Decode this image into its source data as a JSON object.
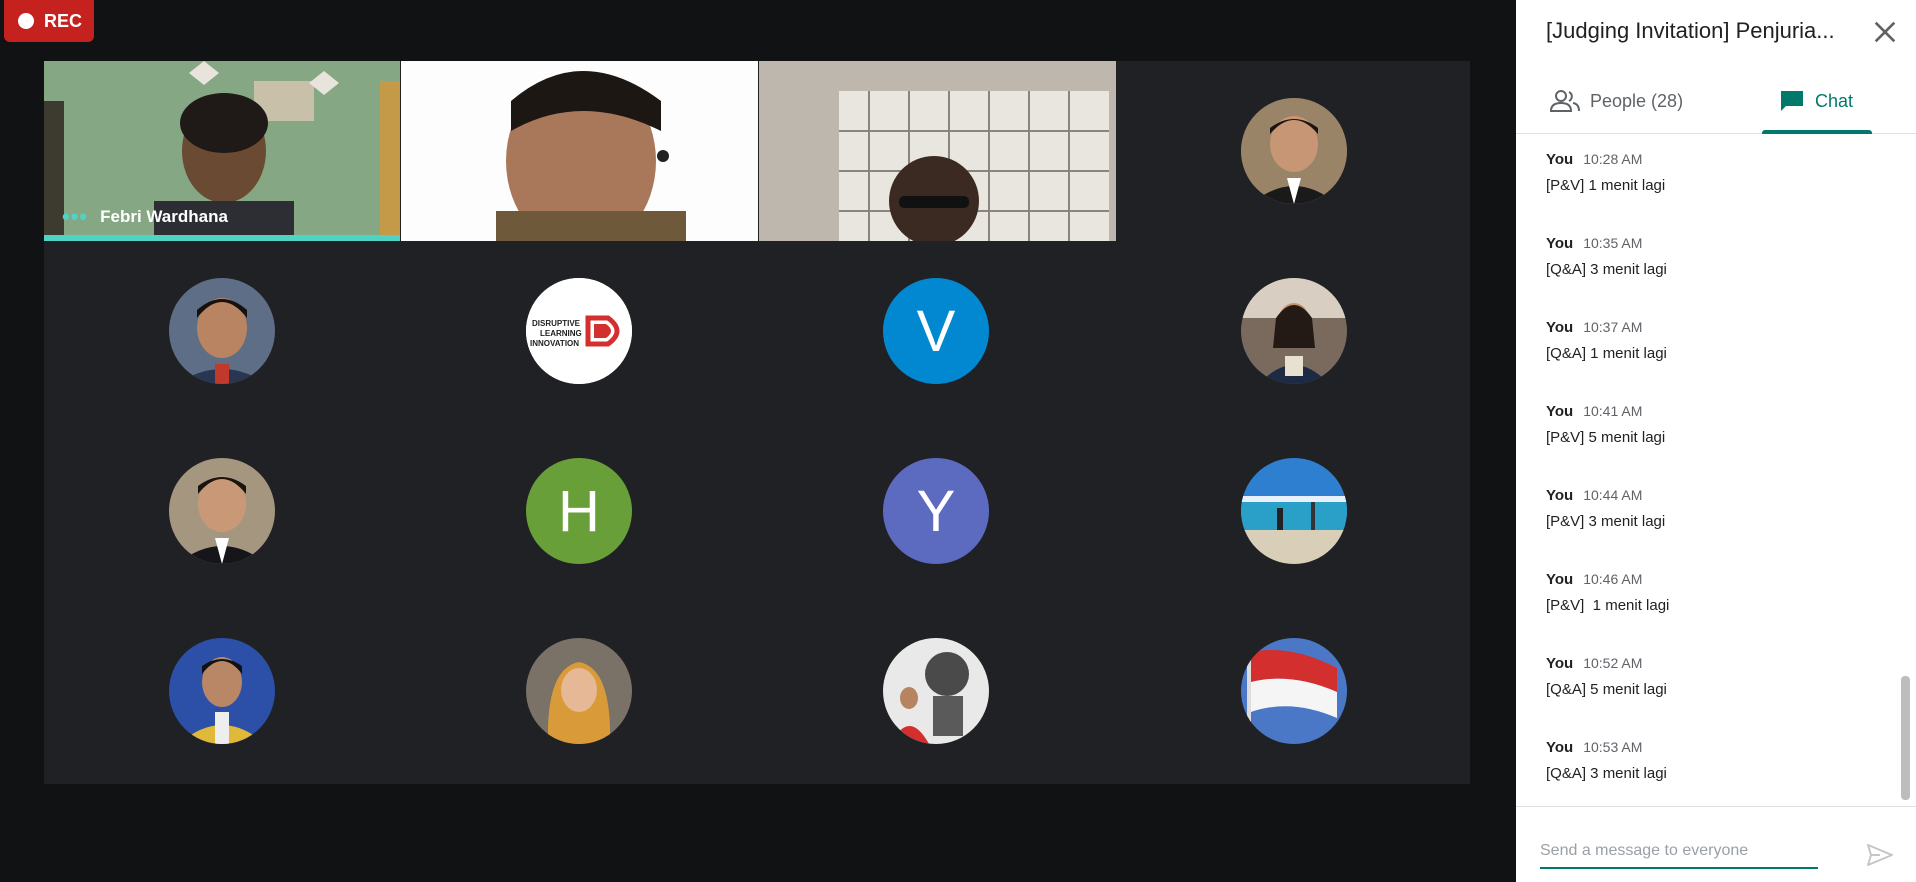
{
  "rec": {
    "label": "REC"
  },
  "videos": [
    {
      "name": "Febri Wardhana",
      "bg": "#7fa07e",
      "active": true
    },
    {
      "name": "",
      "bg": "#d9c9b6",
      "active": false
    },
    {
      "name": "",
      "bg": "#b4b0a8",
      "active": false
    }
  ],
  "participants": [
    {
      "type": "photo",
      "color": "#6b5a4a",
      "icon": "person-photo-icon"
    },
    {
      "type": "photo",
      "color": "#5d6e86",
      "icon": "person-photo-icon"
    },
    {
      "type": "logo",
      "color": "#ffffff",
      "icon": "disruptive-learning-innovation-logo",
      "logo_text": [
        "DISRUPTIVE",
        "LEARNING",
        "INNOVATION"
      ]
    },
    {
      "type": "letter",
      "letter": "V",
      "color": "#0288d1"
    },
    {
      "type": "photo",
      "color": "#7a6a5e",
      "icon": "person-photo-icon"
    },
    {
      "type": "photo",
      "color": "#8a7c70",
      "icon": "person-photo-icon"
    },
    {
      "type": "letter",
      "letter": "H",
      "color": "#689f38"
    },
    {
      "type": "letter",
      "letter": "Y",
      "color": "#5c6bc0"
    },
    {
      "type": "photo",
      "color": "#3f7fc4",
      "icon": "beach-photo-icon"
    },
    {
      "type": "photo",
      "color": "#2c4fa8",
      "icon": "person-photo-icon"
    },
    {
      "type": "photo",
      "color": "#c9a678",
      "icon": "person-photo-icon"
    },
    {
      "type": "photo",
      "color": "#c0392b",
      "icon": "monument-photo-icon"
    },
    {
      "type": "photo",
      "color": "#4a78c7",
      "icon": "flag-photo-icon"
    }
  ],
  "panel": {
    "title": "[Judging Invitation] Penjuria...",
    "tabs": {
      "people": "People (28)",
      "chat": "Chat"
    },
    "messages": [
      {
        "sender": "You",
        "time": "10:28 AM",
        "text": "[P&V] 1 menit lagi"
      },
      {
        "sender": "You",
        "time": "10:35 AM",
        "text": "[Q&A] 3 menit lagi"
      },
      {
        "sender": "You",
        "time": "10:37 AM",
        "text": "[Q&A] 1 menit lagi"
      },
      {
        "sender": "You",
        "time": "10:41 AM",
        "text": "[P&V] 5 menit lagi"
      },
      {
        "sender": "You",
        "time": "10:44 AM",
        "text": "[P&V] 3 menit lagi"
      },
      {
        "sender": "You",
        "time": "10:46 AM",
        "text": "[P&V]  1 menit lagi"
      },
      {
        "sender": "You",
        "time": "10:52 AM",
        "text": "[Q&A] 5 menit lagi"
      },
      {
        "sender": "You",
        "time": "10:53 AM",
        "text": "[Q&A] 3 menit lagi"
      }
    ],
    "input_placeholder": "Send a message to everyone"
  },
  "colors": {
    "accent": "#00796b",
    "rec": "#c5221f",
    "speaking": "#4fd3c4"
  }
}
